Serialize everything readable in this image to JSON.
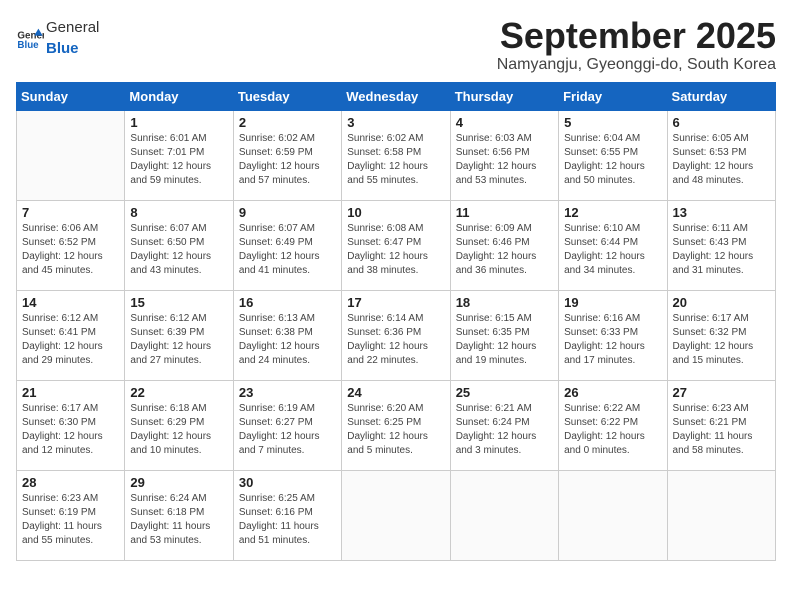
{
  "header": {
    "logo_general": "General",
    "logo_blue": "Blue",
    "month": "September 2025",
    "location": "Namyangju, Gyeonggi-do, South Korea"
  },
  "weekdays": [
    "Sunday",
    "Monday",
    "Tuesday",
    "Wednesday",
    "Thursday",
    "Friday",
    "Saturday"
  ],
  "weeks": [
    [
      {
        "day": "",
        "detail": ""
      },
      {
        "day": "1",
        "detail": "Sunrise: 6:01 AM\nSunset: 7:01 PM\nDaylight: 12 hours\nand 59 minutes."
      },
      {
        "day": "2",
        "detail": "Sunrise: 6:02 AM\nSunset: 6:59 PM\nDaylight: 12 hours\nand 57 minutes."
      },
      {
        "day": "3",
        "detail": "Sunrise: 6:02 AM\nSunset: 6:58 PM\nDaylight: 12 hours\nand 55 minutes."
      },
      {
        "day": "4",
        "detail": "Sunrise: 6:03 AM\nSunset: 6:56 PM\nDaylight: 12 hours\nand 53 minutes."
      },
      {
        "day": "5",
        "detail": "Sunrise: 6:04 AM\nSunset: 6:55 PM\nDaylight: 12 hours\nand 50 minutes."
      },
      {
        "day": "6",
        "detail": "Sunrise: 6:05 AM\nSunset: 6:53 PM\nDaylight: 12 hours\nand 48 minutes."
      }
    ],
    [
      {
        "day": "7",
        "detail": "Sunrise: 6:06 AM\nSunset: 6:52 PM\nDaylight: 12 hours\nand 45 minutes."
      },
      {
        "day": "8",
        "detail": "Sunrise: 6:07 AM\nSunset: 6:50 PM\nDaylight: 12 hours\nand 43 minutes."
      },
      {
        "day": "9",
        "detail": "Sunrise: 6:07 AM\nSunset: 6:49 PM\nDaylight: 12 hours\nand 41 minutes."
      },
      {
        "day": "10",
        "detail": "Sunrise: 6:08 AM\nSunset: 6:47 PM\nDaylight: 12 hours\nand 38 minutes."
      },
      {
        "day": "11",
        "detail": "Sunrise: 6:09 AM\nSunset: 6:46 PM\nDaylight: 12 hours\nand 36 minutes."
      },
      {
        "day": "12",
        "detail": "Sunrise: 6:10 AM\nSunset: 6:44 PM\nDaylight: 12 hours\nand 34 minutes."
      },
      {
        "day": "13",
        "detail": "Sunrise: 6:11 AM\nSunset: 6:43 PM\nDaylight: 12 hours\nand 31 minutes."
      }
    ],
    [
      {
        "day": "14",
        "detail": "Sunrise: 6:12 AM\nSunset: 6:41 PM\nDaylight: 12 hours\nand 29 minutes."
      },
      {
        "day": "15",
        "detail": "Sunrise: 6:12 AM\nSunset: 6:39 PM\nDaylight: 12 hours\nand 27 minutes."
      },
      {
        "day": "16",
        "detail": "Sunrise: 6:13 AM\nSunset: 6:38 PM\nDaylight: 12 hours\nand 24 minutes."
      },
      {
        "day": "17",
        "detail": "Sunrise: 6:14 AM\nSunset: 6:36 PM\nDaylight: 12 hours\nand 22 minutes."
      },
      {
        "day": "18",
        "detail": "Sunrise: 6:15 AM\nSunset: 6:35 PM\nDaylight: 12 hours\nand 19 minutes."
      },
      {
        "day": "19",
        "detail": "Sunrise: 6:16 AM\nSunset: 6:33 PM\nDaylight: 12 hours\nand 17 minutes."
      },
      {
        "day": "20",
        "detail": "Sunrise: 6:17 AM\nSunset: 6:32 PM\nDaylight: 12 hours\nand 15 minutes."
      }
    ],
    [
      {
        "day": "21",
        "detail": "Sunrise: 6:17 AM\nSunset: 6:30 PM\nDaylight: 12 hours\nand 12 minutes."
      },
      {
        "day": "22",
        "detail": "Sunrise: 6:18 AM\nSunset: 6:29 PM\nDaylight: 12 hours\nand 10 minutes."
      },
      {
        "day": "23",
        "detail": "Sunrise: 6:19 AM\nSunset: 6:27 PM\nDaylight: 12 hours\nand 7 minutes."
      },
      {
        "day": "24",
        "detail": "Sunrise: 6:20 AM\nSunset: 6:25 PM\nDaylight: 12 hours\nand 5 minutes."
      },
      {
        "day": "25",
        "detail": "Sunrise: 6:21 AM\nSunset: 6:24 PM\nDaylight: 12 hours\nand 3 minutes."
      },
      {
        "day": "26",
        "detail": "Sunrise: 6:22 AM\nSunset: 6:22 PM\nDaylight: 12 hours\nand 0 minutes."
      },
      {
        "day": "27",
        "detail": "Sunrise: 6:23 AM\nSunset: 6:21 PM\nDaylight: 11 hours\nand 58 minutes."
      }
    ],
    [
      {
        "day": "28",
        "detail": "Sunrise: 6:23 AM\nSunset: 6:19 PM\nDaylight: 11 hours\nand 55 minutes."
      },
      {
        "day": "29",
        "detail": "Sunrise: 6:24 AM\nSunset: 6:18 PM\nDaylight: 11 hours\nand 53 minutes."
      },
      {
        "day": "30",
        "detail": "Sunrise: 6:25 AM\nSunset: 6:16 PM\nDaylight: 11 hours\nand 51 minutes."
      },
      {
        "day": "",
        "detail": ""
      },
      {
        "day": "",
        "detail": ""
      },
      {
        "day": "",
        "detail": ""
      },
      {
        "day": "",
        "detail": ""
      }
    ]
  ]
}
